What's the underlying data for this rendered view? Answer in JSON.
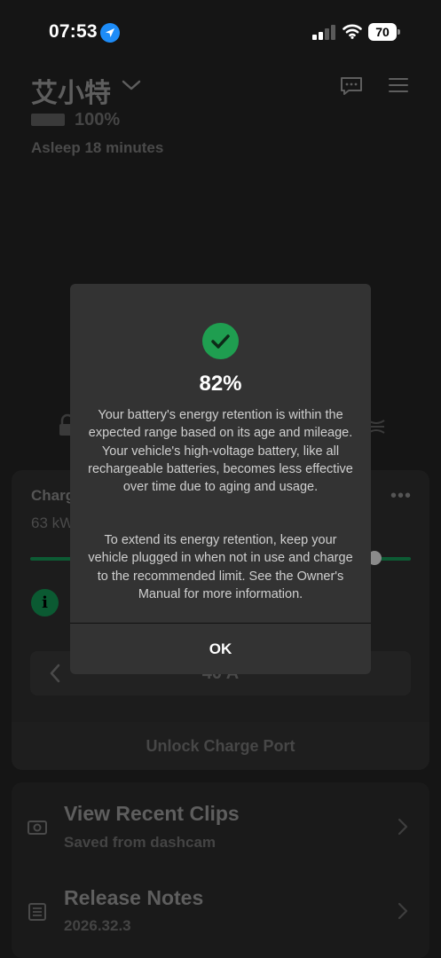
{
  "status_bar": {
    "time": "07:53",
    "battery_level": "70",
    "icons": [
      "location-arrow-icon",
      "cellular-signal-icon",
      "wifi-icon",
      "battery-icon"
    ]
  },
  "vehicle": {
    "name": "艾小特",
    "battery_percent": "100%",
    "status": "Asleep 18 minutes"
  },
  "charging": {
    "title": "Charg",
    "energy": "63 kW",
    "current": "40 A",
    "unlock_label": "Unlock Charge Port",
    "more_label": "•••"
  },
  "list": {
    "clips_title": "View Recent Clips",
    "clips_subtitle": "Saved from dashcam",
    "notes_title": "Release Notes",
    "notes_subtitle": "2026.32.3"
  },
  "modal": {
    "percent": "82%",
    "paragraph_1": "Your battery's energy retention is within the expected range based on its age and mileage. Your vehicle's high-voltage battery, like all rechargeable batteries, becomes less effective over time due to aging and usage.",
    "paragraph_2": "To extend its energy retention, keep your vehicle plugged in when not in use and charge to the recommended limit. See the Owner's Manual for more information.",
    "ok_label": "OK"
  },
  "colors": {
    "accent_green": "#1f9e50",
    "modal_bg": "#333333",
    "location_blue": "#1d8cf8"
  }
}
